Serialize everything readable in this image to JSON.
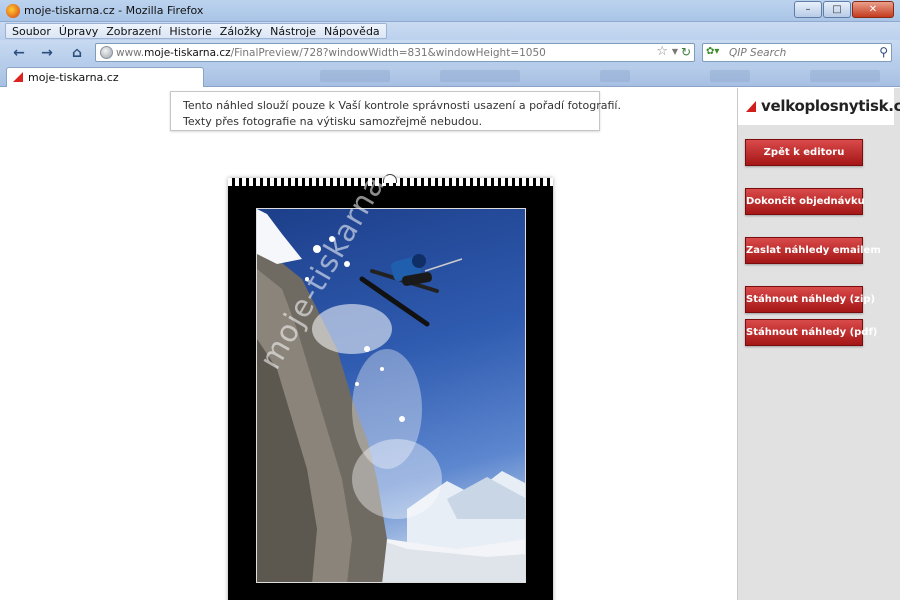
{
  "window": {
    "title": "moje-tiskarna.cz - Mozilla Firefox",
    "controls": {
      "minimize": "–",
      "maximize": "□",
      "close": "✕"
    }
  },
  "menu": {
    "items": [
      "Soubor",
      "Úpravy",
      "Zobrazení",
      "Historie",
      "Záložky",
      "Nástroje",
      "Nápověda"
    ]
  },
  "nav": {
    "url_prefix": "www.",
    "url_domain": "moje-tiskarna.cz",
    "url_path": "/FinalPreview/728?windowWidth=831&windowHeight=1050",
    "search_placeholder": "QIP Search"
  },
  "tabs": [
    {
      "label": "moje-tiskarna.cz"
    }
  ],
  "notice": {
    "line1": "Tento náhled slouží pouze k Vaší kontrole správnosti usazení a pořadí fotografií.",
    "line2": "Texty přes fotografie na výtisku samozřejmě nebudou."
  },
  "preview": {
    "watermark": "moje-tiskarna.cz"
  },
  "sidebar": {
    "brand": "velkoplosnytisk.cz",
    "buttons": [
      "Zpět k editoru",
      "Dokončit objednávku",
      "Zaslat náhledy emailem",
      "Stáhnout náhledy (zip)",
      "Stáhnout náhledy (pdf)"
    ]
  },
  "colors": {
    "accent_red": "#b51d1d",
    "chrome_blue": "#b4cbea"
  }
}
